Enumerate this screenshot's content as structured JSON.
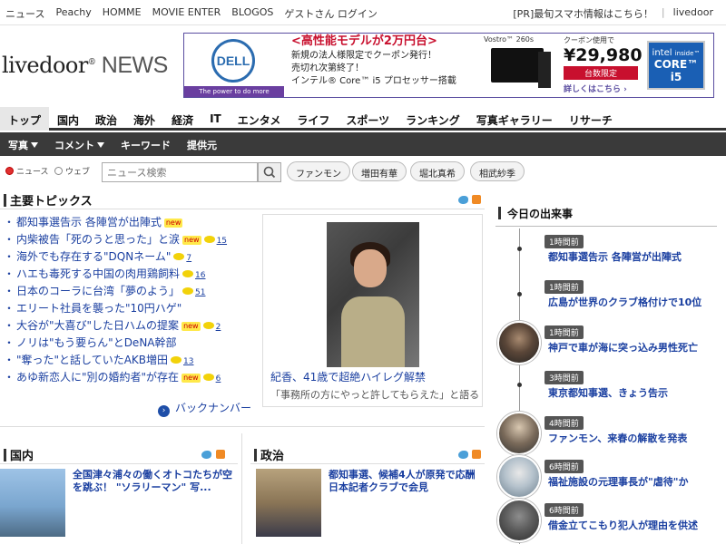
{
  "global_bar": {
    "left_links": [
      "ニュース",
      "Peachy",
      "HOMME",
      "MOVIE ENTER",
      "BLOGOS",
      "ゲストさん ログイン"
    ],
    "right_links": [
      "[PR]最旬スマホ情報はこちら！",
      "livedoor"
    ]
  },
  "logo": {
    "brand": "livedoor",
    "reg": "®",
    "suffix": " NEWS"
  },
  "ad": {
    "dell": "DELL",
    "dell_tagline": "The power to do more",
    "headline": "<高性能モデルが2万円台>",
    "line1": "新規の法人様限定でクーポン発行！",
    "line2": "売切れ次第終了！",
    "line3": "インテル® Core™ i5 プロセッサー搭載",
    "model": "Vostro™ 260s",
    "coupon_label": "クーポン使用で",
    "price": "¥29,980",
    "limited": "台数限定",
    "more": "詳しくはこちら ›",
    "intel": "intel",
    "intel_inside": "inside™",
    "core": "CORE™ i5"
  },
  "nav_primary": [
    "トップ",
    "国内",
    "政治",
    "海外",
    "経済",
    "IT",
    "エンタメ",
    "ライフ",
    "スポーツ",
    "ランキング",
    "写真ギャラリー",
    "リサーチ"
  ],
  "nav_secondary": [
    {
      "label": "写真",
      "dropdown": true
    },
    {
      "label": "コメント",
      "dropdown": true
    },
    {
      "label": "キーワード",
      "dropdown": false
    },
    {
      "label": "提供元",
      "dropdown": false
    }
  ],
  "search": {
    "radio_news": "ニュース",
    "radio_web": "ウェブ",
    "placeholder": "ニュース検索",
    "chips": [
      "ファンモン",
      "増田有華",
      "堀北真希",
      "相武紗季"
    ]
  },
  "topics": {
    "title": "主要トピックス",
    "items": [
      {
        "text": "都知事選告示 各陣営が出陣式",
        "new": "new",
        "count": ""
      },
      {
        "text": "内柴被告「死のうと思った」と涙",
        "new": "new",
        "count": "15"
      },
      {
        "text": "海外でも存在する\"DQNネーム\"",
        "new": "",
        "count": "7"
      },
      {
        "text": "ハエも毒死する中国の肉用鶏飼料",
        "new": "",
        "count": "16"
      },
      {
        "text": "日本のコーラに台湾「夢のよう」",
        "new": "",
        "count": "51"
      },
      {
        "text": "エリート社員を襲った\"10円ハゲ\"",
        "new": "",
        "count": ""
      },
      {
        "text": "大谷が\"大喜び\"した日ハムの提案",
        "new": "new",
        "count": "2"
      },
      {
        "text": "ノリは\"もう要らん\"とDeNA幹部",
        "new": "",
        "count": ""
      },
      {
        "text": "\"奪った\"と話していたAKB増田",
        "new": "",
        "count": "13"
      },
      {
        "text": "あゆ新恋人に\"別の婚約者\"が存在",
        "new": "new",
        "count": "6"
      }
    ],
    "back_number": "バックナンバー"
  },
  "feature": {
    "caption": "紀香、41歳で超絶ハイレグ解禁",
    "sub": "「事務所の方にやっと許してもらえた」と語る"
  },
  "sections": [
    {
      "title": "国内",
      "article": "全国津々浦々の働くオトコたちが空を跳ぶ！ \"ソラリーマン\" 写..."
    },
    {
      "title": "政治",
      "article": "都知事選、候補4人が原発で応酬 日本記者クラブで会見"
    }
  ],
  "today": {
    "title": "今日の出来事",
    "items": [
      {
        "time": "1時間前",
        "headline": "都知事選告示 各陣営が出陣式",
        "avatar": false
      },
      {
        "time": "1時間前",
        "headline": "広島が世界のクラブ格付けで10位",
        "avatar": false
      },
      {
        "time": "1時間前",
        "headline": "神戸で車が海に突っ込み男性死亡",
        "avatar": true
      },
      {
        "time": "3時間前",
        "headline": "東京都知事選、きょう告示",
        "avatar": false
      },
      {
        "time": "4時間前",
        "headline": "ファンモン、来春の解散を発表",
        "avatar": true
      },
      {
        "time": "6時間前",
        "headline": "福祉施設の元理事長が\"虐待\"か",
        "avatar": true
      },
      {
        "time": "6時間前",
        "headline": "借金立てこもり犯人が理由を供述",
        "avatar": true
      }
    ]
  }
}
